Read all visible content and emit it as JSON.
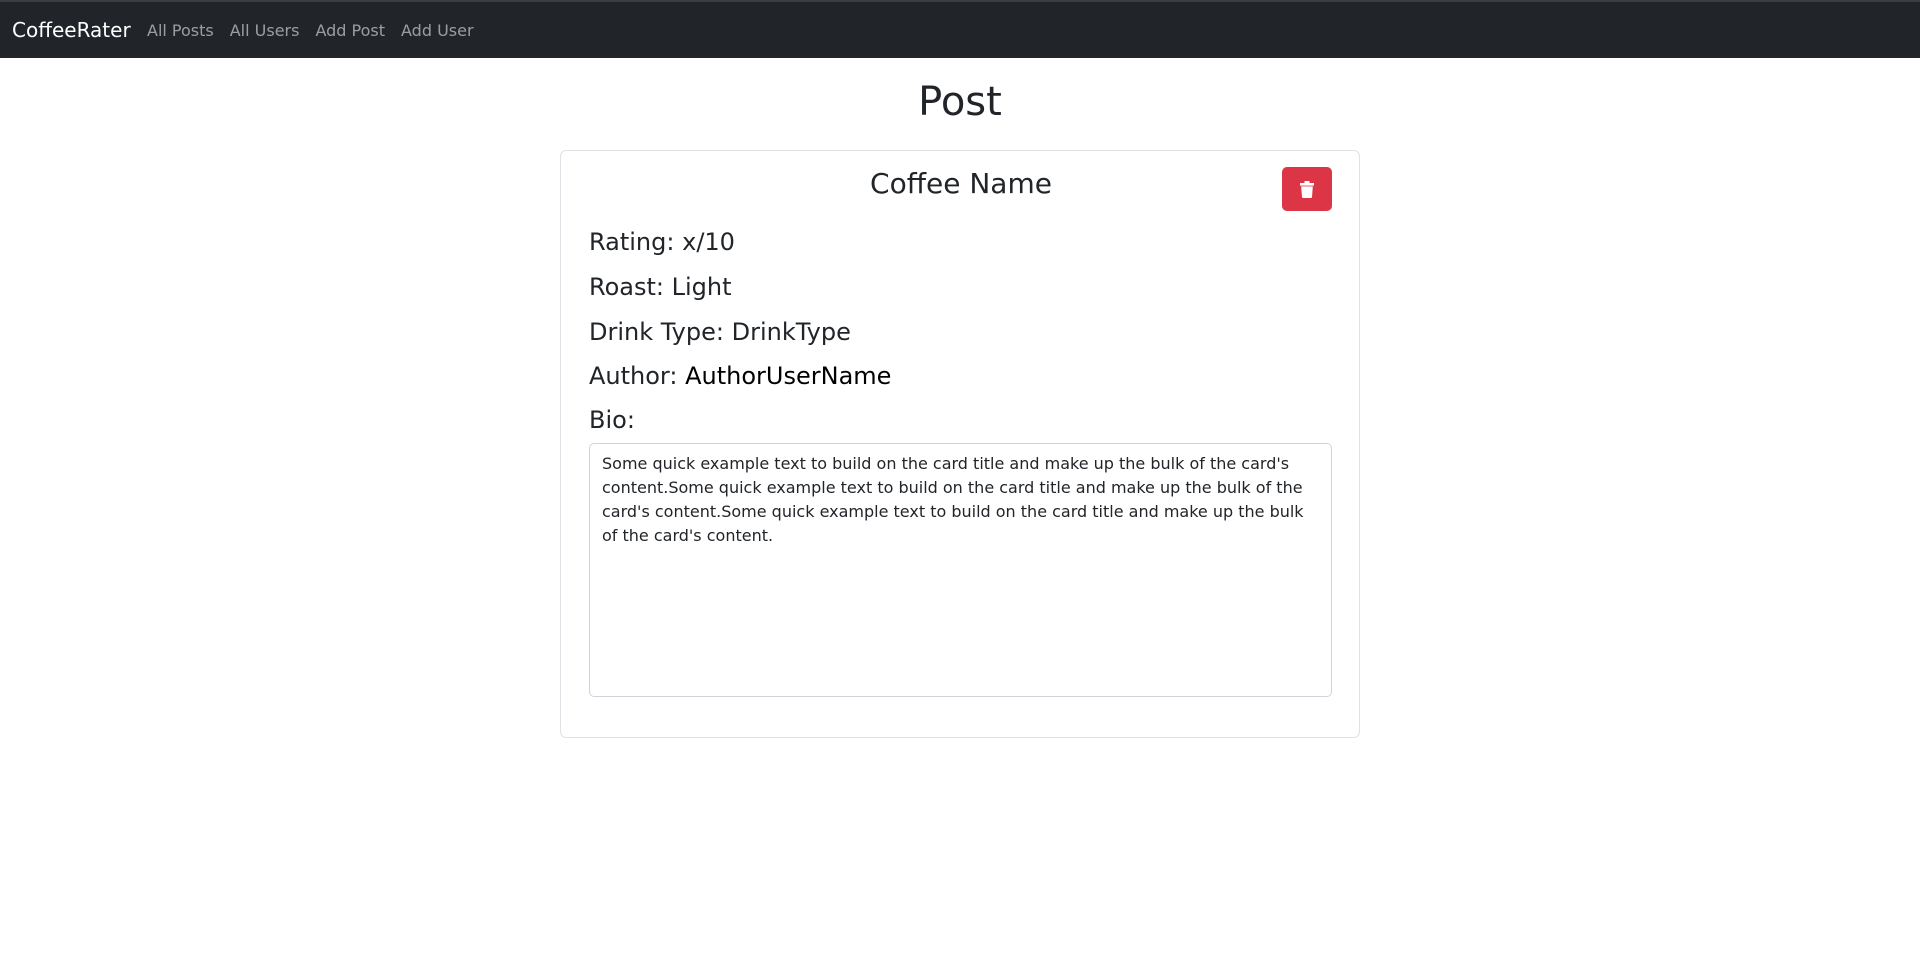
{
  "navbar": {
    "brand": "CoffeeRater",
    "links": [
      {
        "label": "All Posts"
      },
      {
        "label": "All Users"
      },
      {
        "label": "Add Post"
      },
      {
        "label": "Add User"
      }
    ]
  },
  "page": {
    "title": "Post"
  },
  "post": {
    "coffee_name": "Coffee Name",
    "delete_icon": "trash-icon",
    "rating_label": "Rating:",
    "rating_value": "x/10",
    "roast_label": "Roast:",
    "roast_value": "Light",
    "drink_type_label": "Drink Type:",
    "drink_type_value": "DrinkType",
    "author_label": "Author:",
    "author_value": "AuthorUserName",
    "bio_label": "Bio:",
    "bio_text": "Some quick example text to build on the card title and make up the bulk of the card's content.Some quick example text to build on the card title and make up the bulk of the card's content.Some quick example text to build on the card title and make up the bulk of the card's content."
  },
  "colors": {
    "navbar_bg": "#212529",
    "danger": "#dc3545"
  }
}
